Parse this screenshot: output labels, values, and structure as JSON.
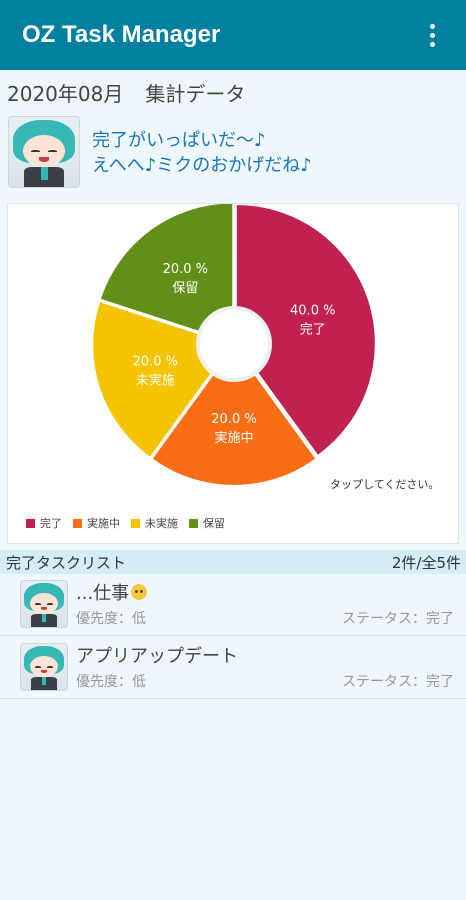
{
  "app": {
    "title": "OZ Task Manager",
    "menu_icon": "more-vert-icon"
  },
  "summary": {
    "period": "2020年08月",
    "heading": "集計データ"
  },
  "speech": {
    "line1": "完了がいっぱいだ～♪",
    "line2": "えへへ♪ミクのおかげだね♪"
  },
  "chart_data": {
    "type": "pie",
    "donut_hole": true,
    "title": "",
    "slices": [
      {
        "label": "完了",
        "value": 40.0,
        "display": "40.0 %",
        "color": "#c0214e"
      },
      {
        "label": "実施中",
        "value": 20.0,
        "display": "20.0 %",
        "color": "#f96d15"
      },
      {
        "label": "未実施",
        "value": 20.0,
        "display": "20.0 %",
        "color": "#f5c400"
      },
      {
        "label": "保留",
        "value": 20.0,
        "display": "20.0 %",
        "color": "#628f18"
      }
    ],
    "legend_position": "bottom-left",
    "hint": "タップしてください。"
  },
  "task_list": {
    "title": "完了タスクリスト",
    "count": "2件/全5件",
    "items": [
      {
        "name": "...仕事",
        "emoji": "pleading-face-emoji",
        "priority": "優先度：低",
        "status": "ステータス：完了"
      },
      {
        "name": "アプリアップデート",
        "priority": "優先度：低",
        "status": "ステータス：完了"
      }
    ]
  },
  "colors": {
    "appbar": "#00809f",
    "background": "#eef7fb",
    "speech_text": "#1b76b7",
    "list_header": "#d5edf7"
  }
}
